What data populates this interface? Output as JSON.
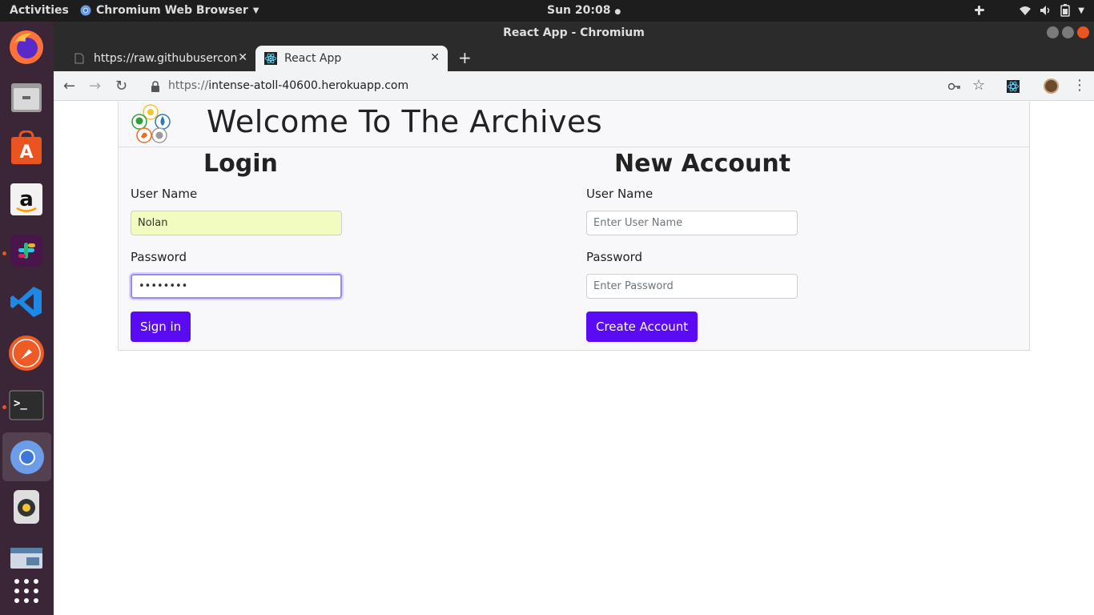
{
  "topbar": {
    "activities": "Activities",
    "app_menu": "Chromium Web Browser",
    "clock": "Sun 20:08"
  },
  "window": {
    "title": "React App - Chromium"
  },
  "tabs": [
    {
      "title": "https://raw.githubusercontent.com",
      "icon": "file-icon"
    },
    {
      "title": "React App",
      "icon": "react-icon"
    }
  ],
  "address_bar": {
    "scheme": "https://",
    "host": "intense-atoll-40600.herokuapp.com"
  },
  "page": {
    "heading": "Welcome To The Archives",
    "login": {
      "title": "Login",
      "username_label": "User Name",
      "username_value": "Nolan",
      "password_label": "Password",
      "password_value": "••••••••",
      "submit": "Sign in"
    },
    "new_account": {
      "title": "New Account",
      "username_label": "User Name",
      "username_placeholder": "Enter User Name",
      "password_label": "Password",
      "password_placeholder": "Enter Password",
      "submit": "Create Account"
    }
  },
  "colors": {
    "accent": "#5b0bf4",
    "dock": "#3a2637",
    "ubuntu_orange": "#e95420"
  }
}
